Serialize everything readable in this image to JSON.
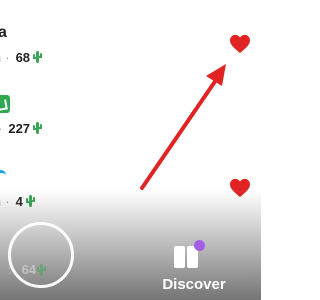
{
  "rows": [
    {
      "title": "a",
      "meta_prefix": "n",
      "dot": "·",
      "count": "68"
    },
    {
      "meta_prefix": "",
      "dot": "·",
      "count": "227"
    },
    {
      "meta_prefix": "n",
      "dot": "·",
      "count": "4"
    }
  ],
  "faded_row": {
    "prefix": ":",
    "count": "64"
  },
  "nav": {
    "discover_label": "Discover"
  },
  "icons": {
    "heart": "heart-icon",
    "cactus": "cactus-emoji",
    "discover": "discover-icon",
    "capture": "capture-button",
    "arrow": "annotation-arrow"
  },
  "colors": {
    "heart": "#e02424",
    "arrow": "#e02424",
    "cactus": "#3aa655",
    "discover_dot": "#a45ee5"
  }
}
